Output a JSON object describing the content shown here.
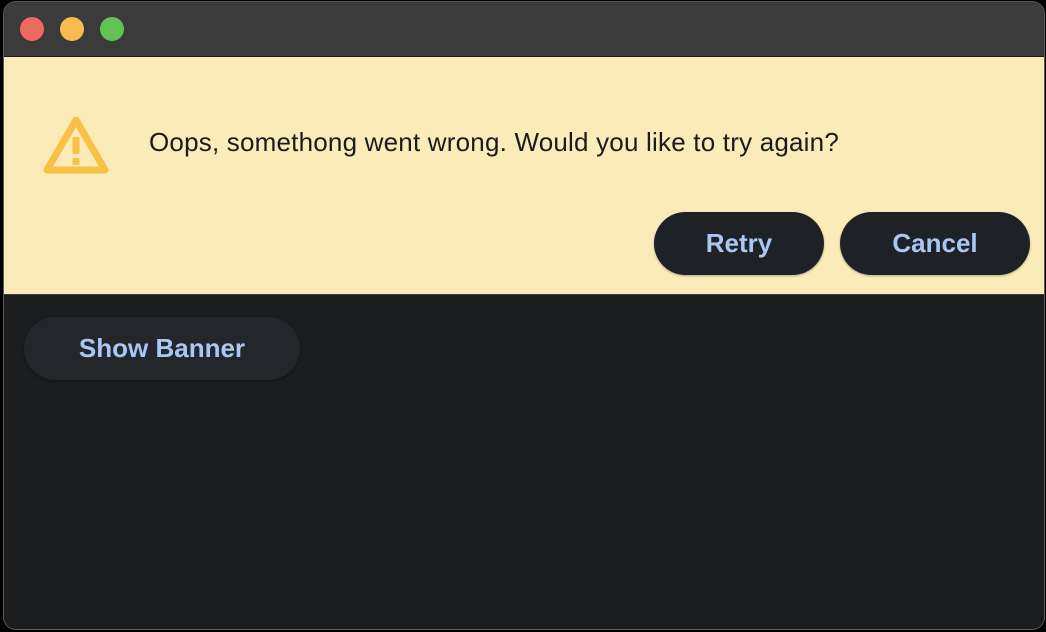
{
  "window": {
    "traffic_lights": [
      "close",
      "minimize",
      "maximize"
    ]
  },
  "banner": {
    "icon": "warning-triangle-icon",
    "icon_color": "#f7c244",
    "background": "#fbebb9",
    "message": "Oops, somethong went wrong. Would you like to try again?",
    "retry_label": "Retry",
    "cancel_label": "Cancel"
  },
  "main": {
    "show_banner_label": "Show Banner"
  },
  "colors": {
    "button_bg": "#1e2226",
    "button_text": "#a9c7f2",
    "content_bg": "#1c1d1f"
  }
}
